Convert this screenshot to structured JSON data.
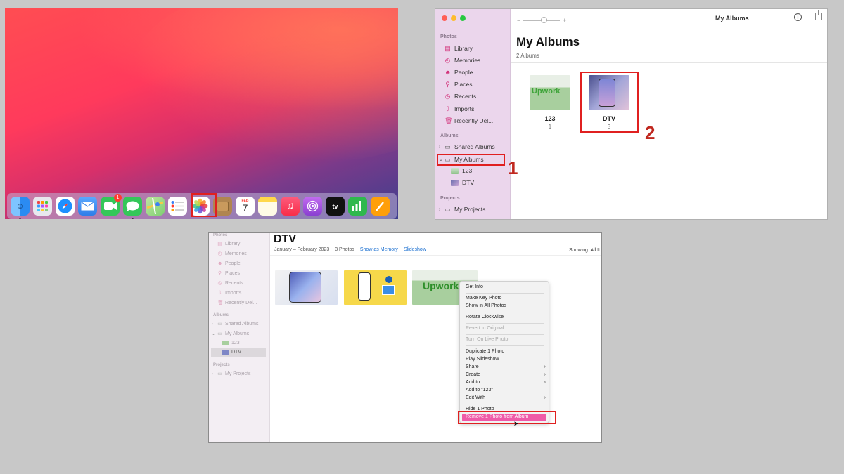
{
  "desktop": {
    "dock_apps": [
      {
        "icon": "finder-icon",
        "color": "#2b8bf2"
      },
      {
        "icon": "launchpad-icon",
        "color": "#e8e8ee"
      },
      {
        "icon": "safari-icon",
        "color": "#1e90ff"
      },
      {
        "icon": "mail-icon",
        "color": "#3b8ef5"
      },
      {
        "icon": "facetime-icon",
        "color": "#34c759",
        "badge": "1"
      },
      {
        "icon": "messages-icon",
        "color": "#34c759"
      },
      {
        "icon": "maps-icon",
        "color": "#9bd37a"
      },
      {
        "icon": "reminders-icon",
        "color": "#ffffff"
      },
      {
        "icon": "photos-icon",
        "color": "#ffffff"
      },
      {
        "icon": "app-icon",
        "color": "#b08550"
      },
      {
        "icon": "calendar-icon",
        "color": "#ffffff",
        "label": "7",
        "sublabel": "FEB"
      },
      {
        "icon": "notes-icon",
        "color": "#ffd84a"
      },
      {
        "icon": "music-icon",
        "color": "#fa3b4f"
      },
      {
        "icon": "podcasts-icon",
        "color": "#a94fe0"
      },
      {
        "icon": "tv-icon",
        "color": "#111111",
        "label": "tv"
      },
      {
        "icon": "numbers-icon",
        "color": "#2fb84d"
      },
      {
        "icon": "pages-icon",
        "color": "#ff9f0a"
      }
    ]
  },
  "albums_window": {
    "window_title": "My Albums",
    "sidebar": {
      "photos_header": "Photos",
      "photos_items": [
        {
          "label": "Library",
          "icon": "library-icon"
        },
        {
          "label": "Memories",
          "icon": "memories-icon"
        },
        {
          "label": "People",
          "icon": "people-icon"
        },
        {
          "label": "Places",
          "icon": "places-icon"
        },
        {
          "label": "Recents",
          "icon": "recents-icon"
        },
        {
          "label": "Imports",
          "icon": "imports-icon"
        },
        {
          "label": "Recently Del...",
          "icon": "trash-icon"
        }
      ],
      "albums_header": "Albums",
      "shared_albums": "Shared Albums",
      "my_albums": "My Albums",
      "sub_albums": [
        "123",
        "DTV"
      ],
      "projects_header": "Projects",
      "my_projects": "My Projects"
    },
    "title": "My Albums",
    "album_count": "2 Albums",
    "albums": [
      {
        "name": "123",
        "count": "1"
      },
      {
        "name": "DTV",
        "count": "3"
      }
    ],
    "step1": "1",
    "step2": "2"
  },
  "dtv_window": {
    "sidebar": {
      "photos_header": "Photos",
      "photos_items": [
        {
          "label": "Library",
          "icon": "library-icon"
        },
        {
          "label": "Memories",
          "icon": "memories-icon"
        },
        {
          "label": "People",
          "icon": "people-icon"
        },
        {
          "label": "Places",
          "icon": "places-icon"
        },
        {
          "label": "Recents",
          "icon": "recents-icon"
        },
        {
          "label": "Imports",
          "icon": "imports-icon"
        },
        {
          "label": "Recently Del...",
          "icon": "trash-icon"
        }
      ],
      "albums_header": "Albums",
      "shared_albums": "Shared Albums",
      "my_albums": "My Albums",
      "sub_albums": [
        "123",
        "DTV"
      ],
      "projects_header": "Projects",
      "my_projects": "My Projects"
    },
    "title": "DTV",
    "date_range": "January – February 2023",
    "photo_count": "3 Photos",
    "show_as_memory": "Show as Memory",
    "slideshow": "Slideshow",
    "showing": "Showing: All It",
    "context_menu": {
      "get_info": "Get Info",
      "make_key_photo": "Make Key Photo",
      "show_in_all_photos": "Show in All Photos",
      "rotate_clockwise": "Rotate Clockwise",
      "revert_to_original": "Revert to Original",
      "turn_on_live_photo": "Turn On Live Photo",
      "duplicate": "Duplicate 1 Photo",
      "play_slideshow": "Play Slideshow",
      "share": "Share",
      "create": "Create",
      "add_to": "Add to",
      "add_to_123": "Add to \"123\"",
      "edit_with": "Edit With",
      "hide": "Hide 1 Photo",
      "remove": "Remove 1 Photo from Album"
    }
  }
}
